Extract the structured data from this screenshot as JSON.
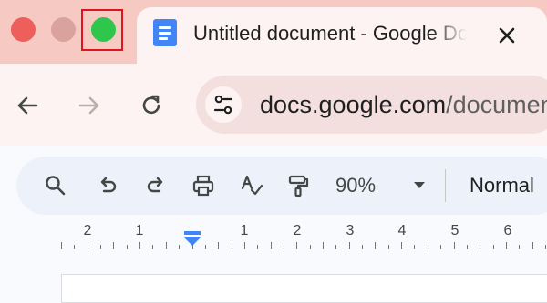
{
  "window": {
    "traffic_lights": {
      "close_color": "#ee5e5a",
      "minimize_color": "#d9a29c",
      "maximize_color": "#2ec64b",
      "highlight_color": "#e0141c"
    }
  },
  "tab": {
    "title": "Untitled document - Google Docs",
    "icon": "google-docs-icon",
    "close_icon": "close-icon"
  },
  "nav": {
    "back_icon": "back-arrow-icon",
    "forward_icon": "forward-arrow-icon",
    "reload_icon": "reload-icon",
    "site_info_icon": "site-settings-icon",
    "url_domain": "docs.google.com",
    "url_path": "/document"
  },
  "toolbar": {
    "icons": [
      "search-icon",
      "undo-icon",
      "redo-icon",
      "print-icon",
      "spellcheck-icon",
      "paint-format-icon"
    ],
    "zoom": "90%",
    "style": "Normal"
  },
  "ruler": {
    "labels": [
      "2",
      "1",
      "1",
      "2",
      "3",
      "4",
      "5",
      "6"
    ]
  },
  "colors": {
    "tab_strip": "#f7c9c3",
    "tab": "#fdf3f2",
    "toolbar": "#edf2fa",
    "accent": "#4285f4"
  }
}
